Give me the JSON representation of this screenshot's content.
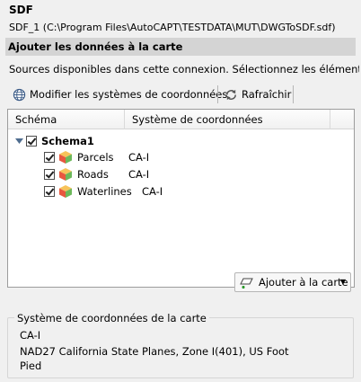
{
  "panel": {
    "title": "SDF",
    "connection": "SDF_1 (C:\\Program Files\\AutoCAPT\\TESTDATA\\MUT\\DWGToSDF.sdf)"
  },
  "section_header": "Ajouter les données à la carte",
  "description": "Sources disponibles dans cette connexion. Sélectionnez les éléments à ajouter",
  "toolbar": {
    "modify_cs_label": "Modifier les systèmes de coordonnées",
    "refresh_label": "Rafraîchir"
  },
  "tree": {
    "columns": [
      "Schéma",
      "Système de coordonnées"
    ],
    "schema": {
      "name": "Schema1",
      "checked": true,
      "expanded": true
    },
    "items": [
      {
        "name": "Parcels",
        "cs": "CA-I",
        "checked": true
      },
      {
        "name": "Roads",
        "cs": "CA-I",
        "checked": true
      },
      {
        "name": "Waterlines",
        "cs": "CA-I",
        "checked": true
      }
    ]
  },
  "add_button_label": "Ajouter à la carte",
  "map_cs_group": {
    "legend": "Système de coordonnées de la carte",
    "code": "CA-I",
    "description_line1": "NAD27 California State Planes, Zone I(401), US Foot",
    "description_line2": "Pied"
  },
  "colors": {
    "section_header_bg": "#d4d4d4",
    "background": "#f0f0f0"
  }
}
